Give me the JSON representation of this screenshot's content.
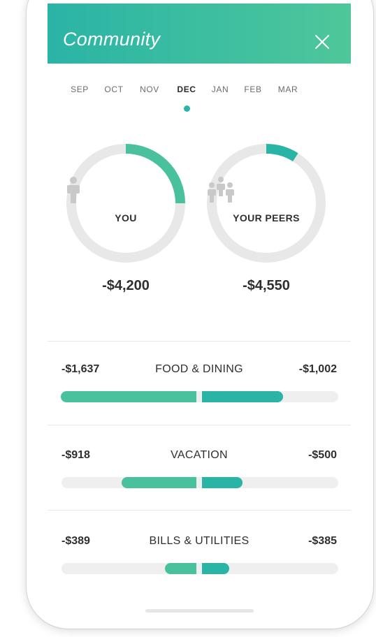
{
  "header": {
    "title": "Community",
    "close_icon": "close-icon"
  },
  "months": [
    {
      "label": "SEP",
      "active": false
    },
    {
      "label": "OCT",
      "active": false
    },
    {
      "label": "NOV",
      "active": false
    },
    {
      "label": "DEC",
      "active": true
    },
    {
      "label": "JAN",
      "active": false
    },
    {
      "label": "FEB",
      "active": false
    },
    {
      "label": "MAR",
      "active": false
    }
  ],
  "summary": {
    "you": {
      "label": "YOU",
      "amount": "-$4,200",
      "progress": 0.25,
      "icon": "person-icon"
    },
    "peers": {
      "label": "YOUR PEERS",
      "amount": "-$4,550",
      "progress": 0.09,
      "icon": "group-icon"
    }
  },
  "categories": [
    {
      "name": "FOOD & DINING",
      "you": "-$1,637",
      "peers": "-$1,002",
      "you_fraction": 1.0,
      "peer_fraction": 0.6
    },
    {
      "name": "VACATION",
      "you": "-$918",
      "peers": "-$500",
      "you_fraction": 0.55,
      "peer_fraction": 0.3
    },
    {
      "name": "BILLS & UTILITIES",
      "you": "-$389",
      "peers": "-$385",
      "you_fraction": 0.23,
      "peer_fraction": 0.2
    }
  ],
  "colors": {
    "header_start": "#2ab4a6",
    "header_end": "#4ec79a",
    "you_accent": "#48c19c",
    "peer_accent": "#2ab4a6",
    "track": "#efefef",
    "ring_track": "#e8e8e8"
  }
}
